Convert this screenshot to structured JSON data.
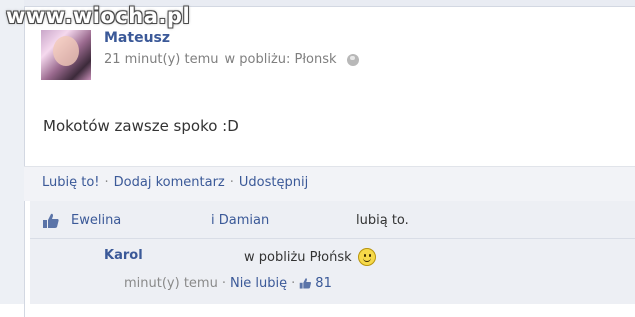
{
  "watermark": "www.wiocha.pl",
  "post": {
    "author": "Mateusz",
    "time": "21 minut(y) temu",
    "location": "w pobliżu: Płonsk",
    "text": "Mokotów zawsze spoko :D"
  },
  "actions": {
    "like": "Lubię to!",
    "comment": "Dodaj komentarz",
    "share": "Udostępnij",
    "separator": "·"
  },
  "likes": {
    "name1": "Ewelina",
    "and_name2": "i Damian",
    "suffix": "lubią to."
  },
  "comment": {
    "author": "Karol",
    "text": "w pobliżu Płońsk",
    "time": "minut(y) temu",
    "unlike": "Nie lubię",
    "like_count": "81"
  },
  "colors": {
    "link": "#3b5998",
    "meta": "#7f7f7f",
    "panel": "#edeff4"
  },
  "icons": [
    "globe-icon",
    "thumbs-up-icon",
    "smiley-icon"
  ]
}
